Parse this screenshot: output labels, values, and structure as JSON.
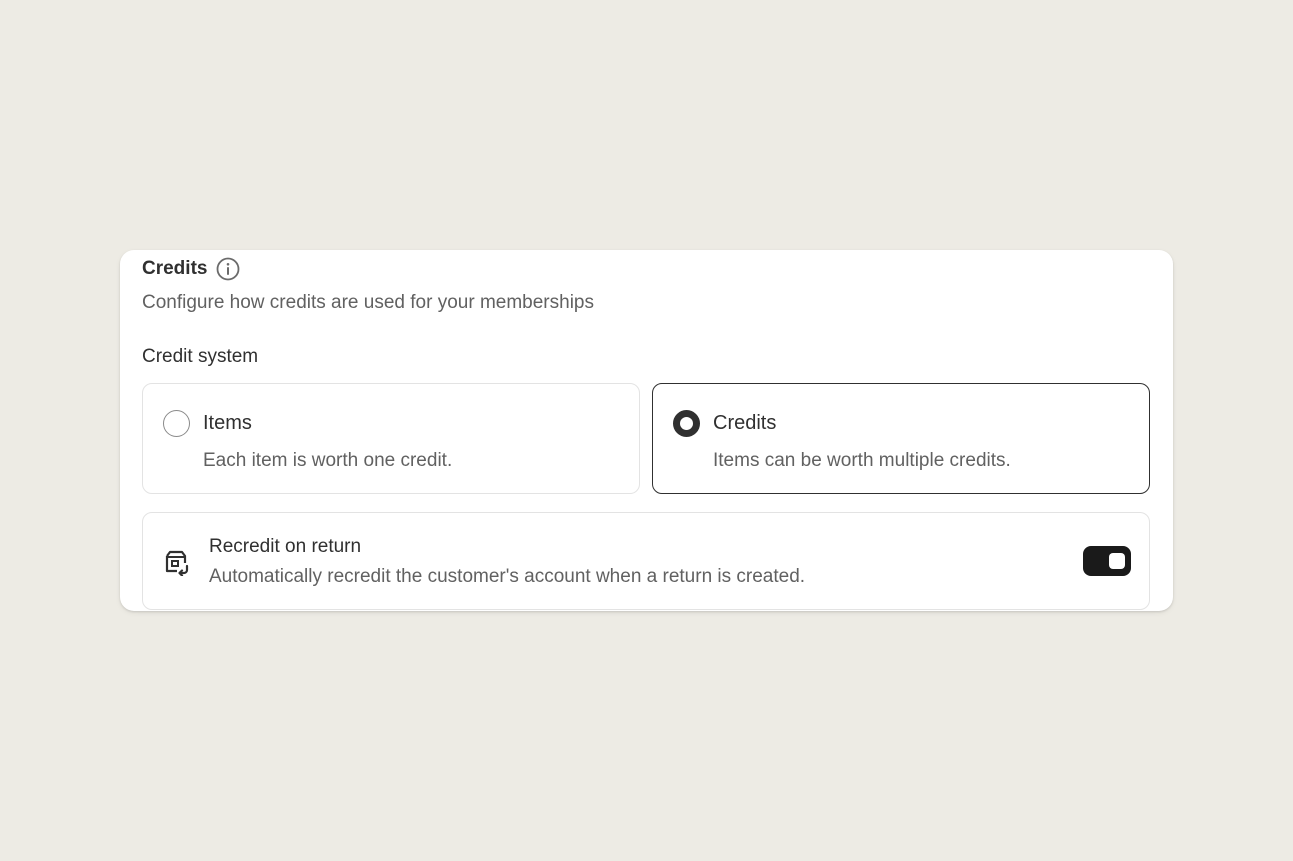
{
  "credits_card": {
    "title": "Credits",
    "subtitle": "Configure how credits are used for your memberships",
    "credit_system_label": "Credit system",
    "options": [
      {
        "label": "Items",
        "description": "Each item is worth one credit.",
        "selected": false
      },
      {
        "label": "Credits",
        "description": "Items can be worth multiple credits.",
        "selected": true
      }
    ],
    "recredit": {
      "title": "Recredit on return",
      "description": "Automatically recredit the customer's account when a return is created.",
      "enabled": true
    }
  },
  "icons": {
    "info": "info-circle-icon",
    "recredit": "return-package-icon"
  },
  "colors": {
    "background": "#edebe4",
    "card": "#ffffff",
    "accent": "#303030",
    "toggle_on": "#1a1a1a"
  }
}
